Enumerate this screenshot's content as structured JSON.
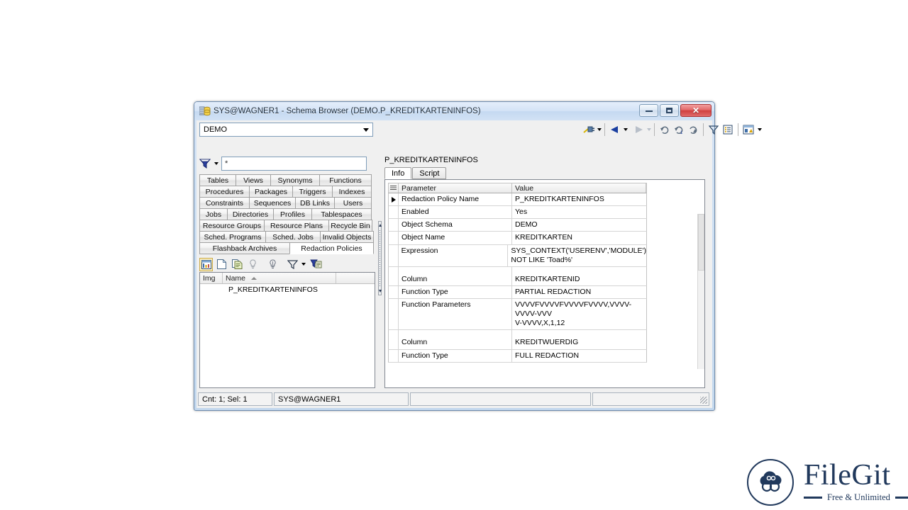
{
  "window": {
    "title": "SYS@WAGNER1 - Schema Browser (DEMO.P_KREDITKARTENINFOS)",
    "icon": "schema-browser-icon",
    "minimize_label": "Minimize",
    "maximize_label": "Maximize",
    "close_label": "Close"
  },
  "toolbar": {
    "schema": {
      "value": "DEMO"
    },
    "buttons": [
      {
        "name": "connect-button",
        "icon": "key-plug-icon"
      },
      {
        "name": "back-button",
        "icon": "left-triangle-icon"
      },
      {
        "name": "forward-button",
        "icon": "right-triangle-icon"
      },
      {
        "name": "refresh-button",
        "icon": "refresh-icon"
      },
      {
        "name": "refresh-all-button",
        "icon": "refresh-all-icon"
      },
      {
        "name": "refresh-list-button",
        "icon": "refresh-list-icon"
      },
      {
        "name": "filter-button",
        "icon": "funnel-icon"
      },
      {
        "name": "columns-button",
        "icon": "list-details-icon"
      },
      {
        "name": "view-options-button",
        "icon": "window-options-icon"
      }
    ]
  },
  "filter": {
    "icon": "funnel-icon",
    "value": "*"
  },
  "object_tabs": [
    [
      "Tables",
      "Views",
      "Synonyms",
      "Functions"
    ],
    [
      "Procedures",
      "Packages",
      "Triggers",
      "Indexes"
    ],
    [
      "Constraints",
      "Sequences",
      "DB Links",
      "Users"
    ],
    [
      "Jobs",
      "Directories",
      "Profiles",
      "Tablespaces"
    ],
    [
      "Resource Groups",
      "Resource Plans",
      "Recycle Bin"
    ],
    [
      "Sched. Programs",
      "Sched. Jobs",
      "Invalid Objects"
    ],
    [
      "Flashback Archives",
      "Redaction Policies"
    ]
  ],
  "active_object_tab": "Redaction Policies",
  "list_toolbar": [
    {
      "name": "grid-view-button",
      "icon": "grid-view-icon",
      "pressed": true
    },
    {
      "name": "new-object-button",
      "icon": "new-document-icon",
      "pressed": false
    },
    {
      "name": "duplicate-object-button",
      "icon": "copy-document-icon",
      "pressed": false
    },
    {
      "name": "hint-off-button",
      "icon": "lightbulb-off-icon",
      "pressed": false
    },
    {
      "name": "hint-on-button",
      "icon": "lightbulb-on-icon",
      "pressed": false
    },
    {
      "name": "list-filter-button",
      "icon": "funnel-icon",
      "pressed": false
    },
    {
      "name": "advanced-filter-button",
      "icon": "funnel-settings-icon",
      "pressed": false
    }
  ],
  "object_list": {
    "columns": [
      "Img",
      "Name"
    ],
    "sort_column": "Name",
    "sort_direction": "asc",
    "rows": [
      {
        "img": "",
        "name": "P_KREDITKARTENINFOS"
      }
    ]
  },
  "detail": {
    "object_name": "P_KREDITKARTENINFOS",
    "tabs": [
      {
        "label": "Info",
        "active": true
      },
      {
        "label": "Script",
        "active": false
      }
    ],
    "grid": {
      "columns": [
        "Parameter",
        "Value"
      ],
      "rows": [
        {
          "parameter": "Redaction Policy Name",
          "value": "P_KREDITKARTENINFOS",
          "selected": true
        },
        {
          "parameter": "Enabled",
          "value": "Yes",
          "selected": false
        },
        {
          "parameter": "Object Schema",
          "value": "DEMO",
          "selected": false
        },
        {
          "parameter": "Object Name",
          "value": "KREDITKARTEN",
          "selected": false
        },
        {
          "parameter": "Expression",
          "value": "SYS_CONTEXT('USERENV','MODULE')\nNOT LIKE 'Toad%'",
          "selected": false
        },
        {
          "parameter": "",
          "value": "",
          "spacer": true
        },
        {
          "parameter": "Column",
          "value": "KREDITKARTENID",
          "selected": false
        },
        {
          "parameter": "Function Type",
          "value": "PARTIAL REDACTION",
          "selected": false
        },
        {
          "parameter": "Function Parameters",
          "value": "VVVVFVVVVFVVVVFVVVV,VVVV-VVVV-VVV\nV-VVVV,X,1,12",
          "selected": false
        },
        {
          "parameter": "",
          "value": "",
          "spacer": true
        },
        {
          "parameter": "Column",
          "value": "KREDITWUERDIG",
          "selected": false
        },
        {
          "parameter": "Function Type",
          "value": "FULL REDACTION",
          "selected": false
        }
      ]
    }
  },
  "status_bar": {
    "count_text": "Cnt: 1;  Sel: 1",
    "connection": "SYS@WAGNER1",
    "middle": "",
    "right": ""
  },
  "watermark": {
    "name": "FileGit",
    "tagline": "Free & Unlimited",
    "icon": "filegit-cloud-icon",
    "color": "#21395c"
  }
}
